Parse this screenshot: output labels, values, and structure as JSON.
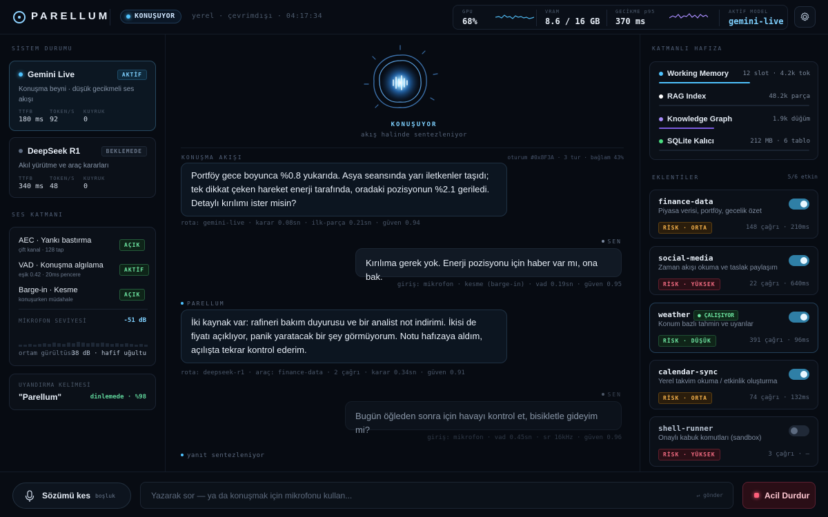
{
  "header": {
    "brand": "PARELLUM",
    "status": "KONUŞUYOR",
    "meta": "yerel · çevrimdışı · 04:17:34",
    "metrics": [
      {
        "label": "GPU",
        "value": "68%"
      },
      {
        "label": "VRAM",
        "value": "8.6 / 16 GB"
      },
      {
        "label": "GECİKME p95",
        "value": "370 ms"
      },
      {
        "label": "AKTİF MODEL",
        "value": "gemini-live"
      }
    ]
  },
  "left": {
    "system_title": "SİSTEM DURUMU",
    "models": [
      {
        "name": "Gemini Live",
        "tag": "AKTİF",
        "desc": "Konuşma beyni · düşük gecikmeli ses akışı",
        "stats": [
          {
            "label": "TTFB",
            "value": "180 ms"
          },
          {
            "label": "TOKEN/S",
            "value": "92"
          },
          {
            "label": "KUYRUK",
            "value": "0"
          }
        ]
      },
      {
        "name": "DeepSeek R1",
        "tag": "BEKLEMEDE",
        "desc": "Akıl yürütme ve araç kararları",
        "stats": [
          {
            "label": "TTFB",
            "value": "340 ms"
          },
          {
            "label": "TOKEN/S",
            "value": "48"
          },
          {
            "label": "KUYRUK",
            "value": "0"
          }
        ]
      }
    ],
    "voice_title": "SES KATMANI",
    "voice": [
      {
        "title": "AEC · Yankı bastırma",
        "sub": "çift kanal · 128 tap",
        "tag": "AÇIK"
      },
      {
        "title": "VAD · Konuşma algılama",
        "sub": "eşik 0.42 · 20ms pencere",
        "tag": "AKTİF"
      },
      {
        "title": "Barge-in · Kesme",
        "sub": "konuşurken müdahale",
        "tag": "AÇIK"
      }
    ],
    "mic_label": "MİKROFON SEVİYESİ",
    "mic_value": "-51 dB",
    "noise_label": "ortam gürültüsü",
    "noise_value": "38 dB · hafif uğultu",
    "wake_title": "UYANDIRMA KELİMESİ",
    "wake_word": "\"Parellum\"",
    "wake_status": "dinlemede · %98"
  },
  "center": {
    "orb_label": "KONUŞUYOR",
    "orb_sub": "akış halinde sentezleniyor",
    "conv_title": "KONUŞMA AKIŞI",
    "conv_meta": "oturum #0x8F3A · 3 tur · bağlam 43%",
    "messages": [
      {
        "text": "Portföy gece boyunca %0.8 yukarıda. Asya seansında yarı iletkenler taşıdı; tek dikkat çeken hareket enerji tarafında, oradaki pozisyonun %2.1 geriledi. Detaylı kırılımı ister misin?",
        "meta": "rota: gemini-live · karar 0.08sn · ilk-parça 0.21sn · güven 0.94"
      },
      {
        "speaker": "SEN",
        "text": "Kırılıma gerek yok. Enerji pozisyonu için haber var mı, ona bak.",
        "meta": "giriş: mikrofon · kesme (barge-in) · vad 0.19sn · güven 0.95"
      },
      {
        "speaker": "PARELLUM",
        "text": "İki kaynak var: rafineri bakım duyurusu ve bir analist not indirimi. İkisi de fiyatı açıklıyor, panik yaratacak bir şey görmüyorum. Notu hafızaya aldım, açılışta tekrar kontrol ederim.",
        "meta": "rota: deepseek-r1 · araç: finance-data · 2 çağrı · karar 0.34sn · güven 0.91"
      },
      {
        "speaker": "SEN",
        "text": "Bugün öğleden sonra için havayı kontrol et, bisikletle gideyim mi?",
        "meta": "giriş: mikrofon · vad 0.45sn · sr 16kHz · güven 0.96"
      }
    ],
    "typing": "yanıt sentezleniyor"
  },
  "right": {
    "memory_title": "KATMANLI HAFIZA",
    "memory": [
      {
        "name": "Working Memory",
        "info": "12 slot · 4.2k tok",
        "color": "#4fc3ff",
        "fill": 0.75
      },
      {
        "name": "RAG Index",
        "info": "48.2k parça",
        "color": "#ffffff",
        "fill": 0.0
      },
      {
        "name": "Knowledge Graph",
        "info": "1.9k düğüm",
        "color": "#a78bfa",
        "fill": 0.5
      },
      {
        "name": "SQLite Kalıcı",
        "info": "212 MB · 6 tablo",
        "color": "#4ade80",
        "fill": 0.0
      }
    ],
    "plugins_title": "EKLENTİLER",
    "plugins_count": "5/6 etkin",
    "plugins": [
      {
        "name": "finance-data",
        "desc": "Piyasa verisi, portföy, gecelik özet",
        "risk": "RİSK · ORTA",
        "stats": "148 çağrı · 210ms",
        "on": true
      },
      {
        "name": "social-media",
        "desc": "Zaman akışı okuma ve taslak paylaşım",
        "risk": "RİSK · YÜKSEK",
        "stats": "22 çağrı · 640ms",
        "on": true
      },
      {
        "name": "weather",
        "badge": "ÇALIŞIYOR",
        "desc": "Konum bazlı tahmin ve uyarılar",
        "risk": "RİSK · DÜŞÜK",
        "stats": "391 çağrı · 96ms",
        "on": true
      },
      {
        "name": "calendar-sync",
        "desc": "Yerel takvim okuma / etkinlik oluşturma",
        "risk": "RİSK · ORTA",
        "stats": "74 çağrı · 132ms",
        "on": true
      },
      {
        "name": "shell-runner",
        "desc": "Onaylı kabuk komutları (sandbox)",
        "risk": "RİSK · YÜKSEK",
        "stats": "3 çağrı · —",
        "on": false
      }
    ]
  },
  "footer": {
    "interrupt_label": "Sözümü kes",
    "interrupt_hint": "boşluk",
    "input_placeholder": "Yazarak sor — ya da konuşmak için mikrofonu kullan...",
    "send_hint": "↵ gönder",
    "stop_label": "Acil Durdur"
  }
}
